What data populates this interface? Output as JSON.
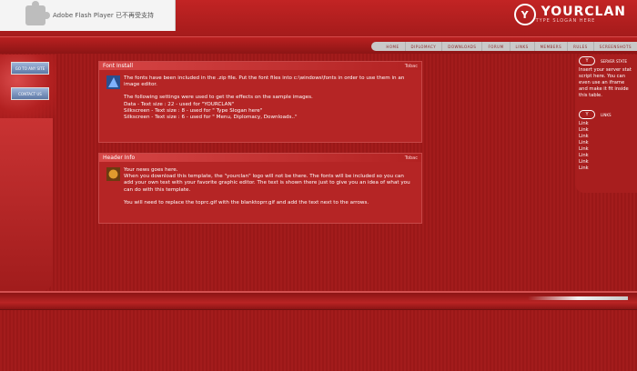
{
  "flash_bar": {
    "text": "Adobe Flash Player 已不再受支持"
  },
  "logo": {
    "icon": "Y",
    "name": "YOURCLAN",
    "slogan": "TYPE SLOGAN HERE"
  },
  "nav": {
    "items": [
      "HOME",
      "DIPLOMACY",
      "DOWNLOADS",
      "FORUM",
      "LINKS",
      "MEMBERS",
      "RULES",
      "SCREENSHOTS"
    ]
  },
  "left_tabs": {
    "tab1": "GO TO ANY SITE",
    "tab2": "CONTACT US"
  },
  "font_install": {
    "title": "Font Install",
    "right_label": "Tobac",
    "line1": "The fonts have been included in the .zip file. Put the font files into c:\\windows\\fonts in order to use them in an image editor.",
    "line2": "The following settings were used to get the effects on the sample images.",
    "line3": "Data - Text size : 22 - used for \"YOURCLAN\"",
    "line4": "Silkscreen - Text size : 8 - used for \" Type Slogan here\"",
    "line5": "Silkscreen - Text size : 6 - used for \" Menu, Diplomacy, Downloads..\""
  },
  "header_info": {
    "title": "Header Info",
    "right_label": "Tobac",
    "line1": "Your news goes here.",
    "line2": "When you download this template, the \"yourclan\" logo will not be there. The fonts will be included so you can add your own text with your favorite graphic editor. The text is shown there just to give you an idea of what you can do with this template.",
    "line3": "You will need to replace the toprc.gif with the blanktoprr.gif and add the text next to the arrows."
  },
  "server_state": {
    "badge": "Y",
    "label": "SERVER STATE",
    "text": "Insert your server stat script here. You can even use an iframe and make it fit inside this table."
  },
  "links": {
    "badge": "Y",
    "label": "LINKS",
    "items": [
      "Link",
      "Link",
      "Link",
      "Link",
      "Link",
      "Link",
      "Link",
      "Link"
    ]
  }
}
